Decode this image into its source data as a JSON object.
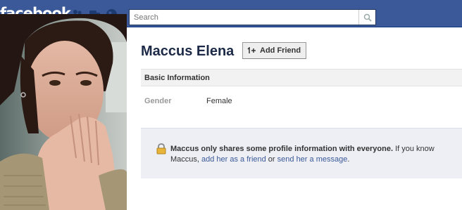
{
  "header": {
    "logo": "facebook",
    "search_placeholder": "Search",
    "colors": {
      "bar": "#3b5998",
      "link": "#3b5998"
    }
  },
  "profile": {
    "name": "Maccus Elena",
    "add_friend_label": "Add Friend"
  },
  "basic_info": {
    "title": "Basic Information",
    "rows": [
      {
        "label": "Gender",
        "value": "Female"
      }
    ]
  },
  "privacy_notice": {
    "bold": "Maccus only shares some profile information with everyone.",
    "text1": " If you know Maccus, ",
    "link1": "add her as a friend",
    "text2": " or ",
    "link2": "send her a message",
    "text3": "."
  },
  "icons": [
    "friend-requests-icon",
    "messages-icon",
    "notifications-globe-icon",
    "search-icon",
    "add-friend-icon",
    "lock-icon"
  ]
}
